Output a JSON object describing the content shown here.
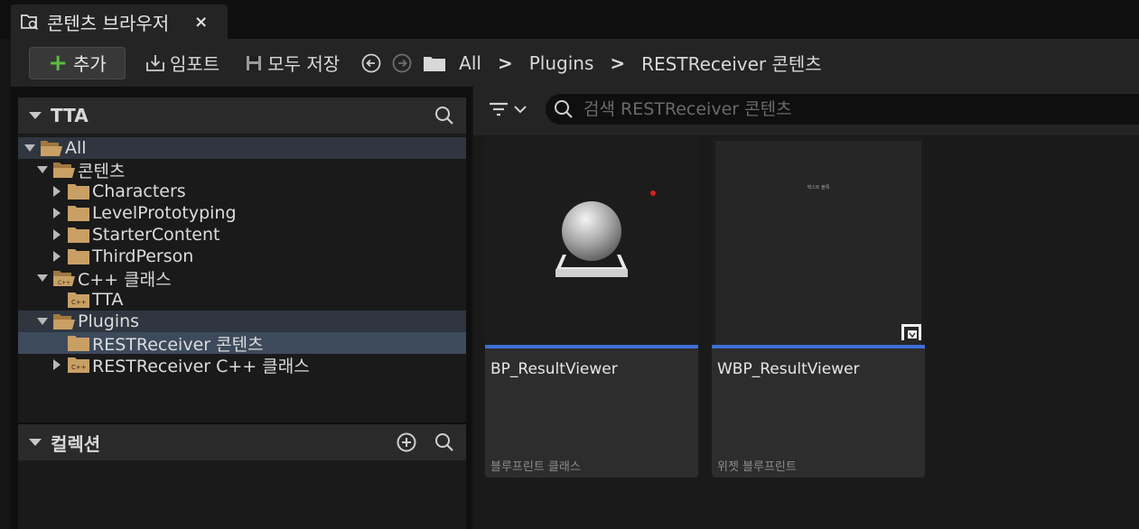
{
  "tab": {
    "title": "콘텐츠 브라우저",
    "close": "×"
  },
  "toolbar": {
    "add_label": "추가",
    "import_label": "임포트",
    "save_all_label": "모두 저장",
    "breadcrumbs": [
      "All",
      "Plugins",
      "RESTReceiver 콘텐츠"
    ],
    "separator": ">"
  },
  "sources": {
    "title": "TTA",
    "tree": [
      {
        "label": "All",
        "level": 0,
        "expanded": true
      },
      {
        "label": "콘텐츠",
        "level": 1,
        "expanded": true
      },
      {
        "label": "Characters",
        "level": 2
      },
      {
        "label": "LevelPrototyping",
        "level": 2
      },
      {
        "label": "StarterContent",
        "level": 2
      },
      {
        "label": "ThirdPerson",
        "level": 2
      },
      {
        "label": "C++ 클래스",
        "level": 1,
        "expanded": true
      },
      {
        "label": "TTA",
        "level": 2
      },
      {
        "label": "Plugins",
        "level": 1,
        "expanded": true
      },
      {
        "label": "RESTReceiver 콘텐츠",
        "level": 2,
        "selected": true
      },
      {
        "label": "RESTReceiver C++ 클래스",
        "level": 2
      }
    ]
  },
  "collections": {
    "title": "컬렉션"
  },
  "search": {
    "placeholder": "검색 RESTReceiver 콘텐츠"
  },
  "assets": [
    {
      "name": "BP_ResultViewer",
      "type": "블루프린트 클래스"
    },
    {
      "name": "WBP_ResultViewer",
      "type": "위젯 블루프린트",
      "thumb_text": "텍스트 블록"
    }
  ],
  "colors": {
    "accent_blue": "#3d6fd6",
    "add_green": "#5dbb3f",
    "folder": "#c8a064",
    "selected_row": "#3d4a5c"
  }
}
